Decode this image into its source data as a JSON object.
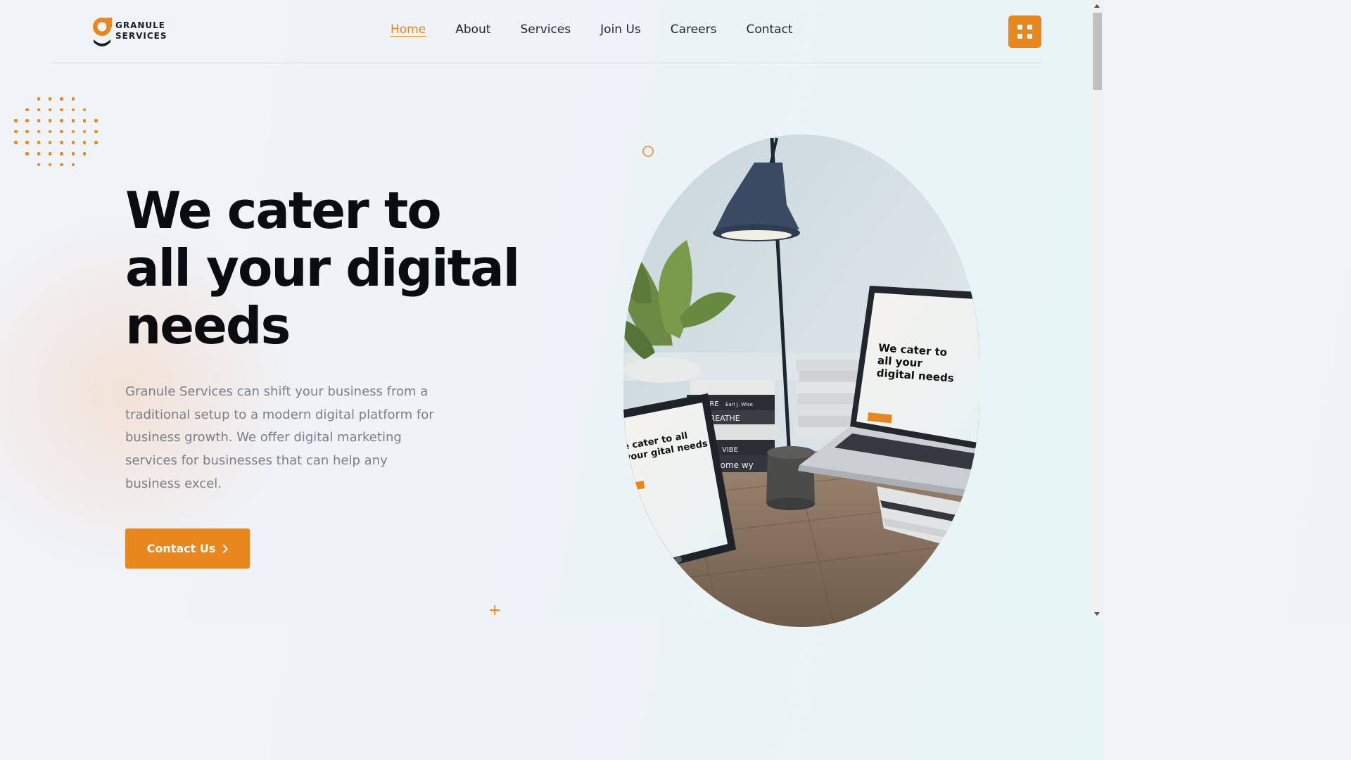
{
  "brand": {
    "logo_line1": "GRANULE",
    "logo_line2": "SERVICES",
    "accent": "#e8871e"
  },
  "nav": {
    "items": [
      {
        "label": "Home",
        "active": true
      },
      {
        "label": "About",
        "active": false
      },
      {
        "label": "Services",
        "active": false
      },
      {
        "label": "Join Us",
        "active": false
      },
      {
        "label": "Careers",
        "active": false
      },
      {
        "label": "Contact",
        "active": false
      }
    ],
    "menu_icon": "grid-icon"
  },
  "hero": {
    "title": "We cater to all your digital needs",
    "description": "Granule Services can shift your business from a traditional setup to a modern digital platform for business growth. We offer digital marketing services for businesses that can help any business excel.",
    "cta_label": "Contact Us",
    "cta_icon": "chevron-right-icon",
    "image_alt": "workspace with laptop, tablet, lamp and plant",
    "mock_screen_title": "We cater to all your digital needs",
    "mock_tablet_title": "e cater to all your gital needs",
    "book_labels": [
      "URE",
      "Earl J. Wise",
      "BREATHE",
      "VIBE",
      "home wy"
    ]
  },
  "decor": {
    "plus_symbol": "+"
  }
}
